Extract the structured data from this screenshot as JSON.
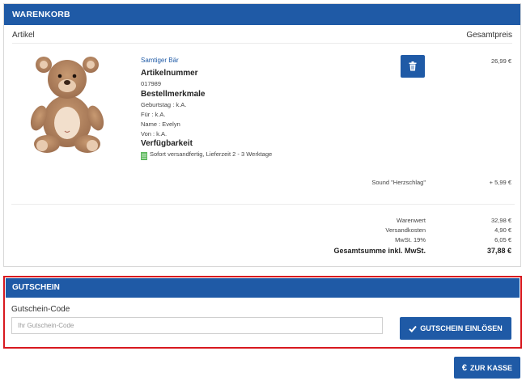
{
  "cart": {
    "title": "WARENKORB",
    "col_article": "Artikel",
    "col_total": "Gesamtpreis",
    "item": {
      "name": "Samtiger Bär",
      "article_number_label": "Artikelnummer",
      "article_number": "017989",
      "order_features_label": "Bestellmerkmale",
      "features": [
        "Geburtstag : k.A.",
        "Für : k.A.",
        "Name : Evelyn",
        "Von : k.A."
      ],
      "availability_label": "Verfügbarkeit",
      "availability_text": "Sofort versandfertig, Lieferzeit 2 - 3 Werktage",
      "price": "26,99 €",
      "addon_label": "Sound \"Herzschlag\"",
      "addon_price": "+ 5,99 €"
    },
    "summary": {
      "goods_value_label": "Warenwert",
      "goods_value": "32,98 €",
      "shipping_label": "Versandkosten",
      "shipping": "4,90 €",
      "vat_label": "MwSt. 19%",
      "vat": "6,05 €",
      "total_label": "Gesamtsumme inkl. MwSt.",
      "total": "37,88 €"
    }
  },
  "voucher": {
    "title": "GUTSCHEIN",
    "code_label": "Gutschein-Code",
    "code_placeholder": "Ihr Gutschein-Code",
    "code_value": "",
    "redeem_label": "GUTSCHEIN EINLÖSEN"
  },
  "checkout": {
    "label": "ZUR KASSE",
    "currency_symbol": "€"
  },
  "colors": {
    "brand_blue": "#1f5aa6",
    "highlight_red": "#d8191f",
    "availability_green": "#5cb85c"
  }
}
